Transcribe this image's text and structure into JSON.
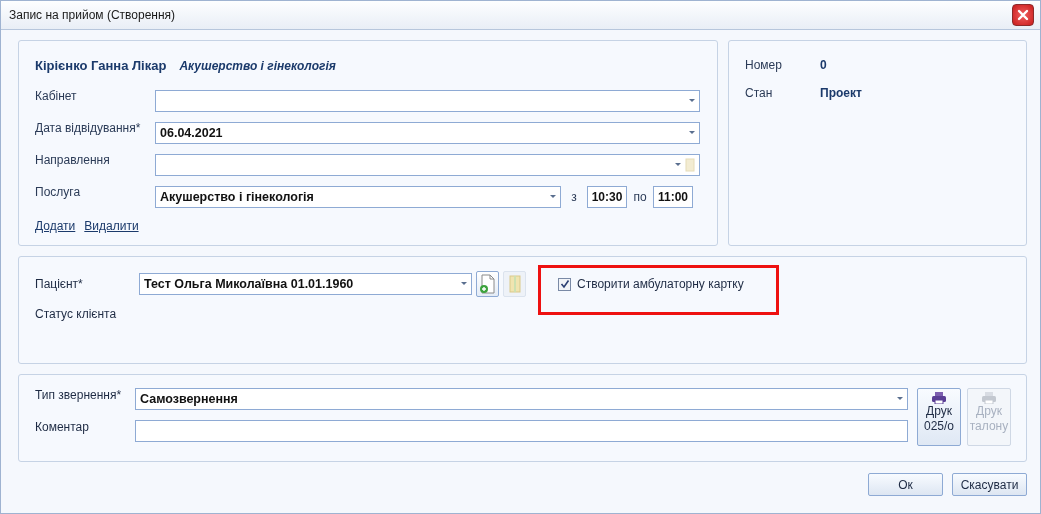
{
  "window": {
    "title": "Запис на прийом (Створення)"
  },
  "doctor": {
    "name": "Кірієнко Ганна Лікар",
    "specialty": "Акушерство і гінекологія"
  },
  "fields": [
    {
      "kind": "dropdown",
      "label": "Кабінет"
    },
    {
      "kind": "dropdown",
      "label": "Дата відвідування*",
      "value": "06.04.2021"
    },
    {
      "kind": "dropdown_folder",
      "label": "Направлення"
    },
    {
      "kind": "service",
      "label": "Послуга",
      "value": "Акушерство і гінекологія",
      "from_label": "з",
      "from": "10:30",
      "to_label": "по",
      "to": "11:00"
    }
  ],
  "links": [
    "Додати",
    "Видалити"
  ],
  "info": [
    {
      "label": "Номер",
      "value": "0"
    },
    {
      "label": "Стан",
      "value": "Проект"
    }
  ],
  "patient": {
    "label": "Пацієнт*",
    "value": "Тест Ольга Миколаївна 01.01.1960",
    "status_label": "Статус клієнта",
    "create_card": {
      "label": "Створити амбулаторну картку",
      "checked": true,
      "highlighted": true
    }
  },
  "appeal": {
    "type_label": "Тип звернення*",
    "type_value": "Самозвернення",
    "comment_label": "Коментар",
    "print_buttons": [
      {
        "lines": [
          "Друк",
          "025/о"
        ],
        "disabled": false
      },
      {
        "lines": [
          "Друк",
          "талону"
        ],
        "disabled": true
      }
    ]
  },
  "buttons": [
    "Ок",
    "Скасувати"
  ]
}
